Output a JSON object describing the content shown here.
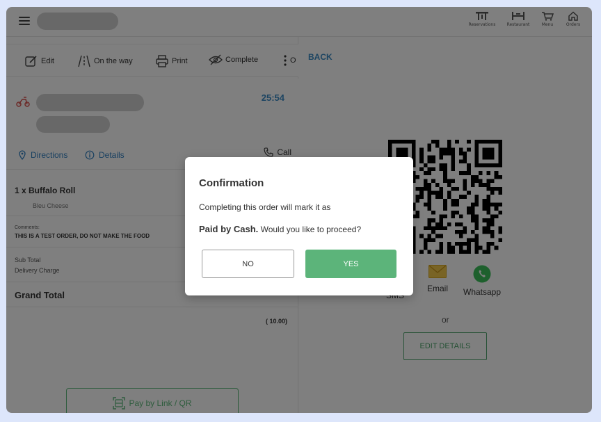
{
  "topbar": {
    "nav": [
      {
        "label": "Reservations",
        "icon": "table-icon"
      },
      {
        "label": "Restaurant",
        "icon": "restaurant-icon"
      },
      {
        "label": "Menu",
        "icon": "cart-icon"
      },
      {
        "label": "Orders",
        "icon": "home-icon"
      }
    ]
  },
  "toolbar": {
    "edit": "Edit",
    "on_the_way": "On the way",
    "print": "Print",
    "complete": "Complete",
    "more_partial": "O"
  },
  "customer": {
    "timer": "25:54",
    "directions": "Directions",
    "details": "Details",
    "call": "Call"
  },
  "order": {
    "item_name": "1 x  Buffalo Roll",
    "item_modifier": "Bleu Cheese",
    "comments_label": "Comments:",
    "comments": "THIS IS A TEST ORDER, DO NOT MAKE THE FOOD",
    "sub_total": "Sub Total",
    "delivery_charge": "Delivery Charge",
    "grand_total": "Grand Total",
    "amount": "(  10.00)",
    "pay_by_link": "Pay by Link / QR"
  },
  "right": {
    "back": "BACK",
    "sms": "SMS",
    "email": "Email",
    "whatsapp": "Whatsapp",
    "or": "or",
    "edit_details": "EDIT DETAILS"
  },
  "modal": {
    "title": "Confirmation",
    "line1": "Completing this order will mark it as",
    "bold": "Paid by Cash.",
    "line2": " Would you like to proceed?",
    "no": "NO",
    "yes": "YES"
  },
  "colors": {
    "accent_blue": "#3a8ac4",
    "accent_green": "#5cb47a",
    "overlay": "rgba(0,0,0,0.5)"
  }
}
